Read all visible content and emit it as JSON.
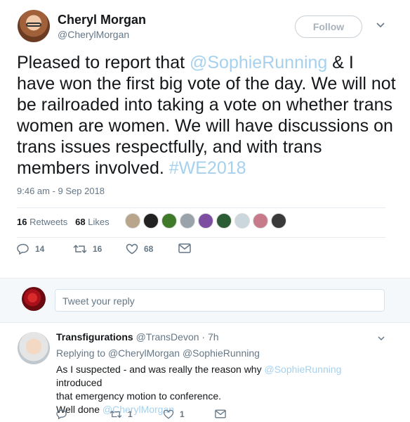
{
  "tweet": {
    "author_name": "Cheryl Morgan",
    "author_handle": "@CherylMorgan",
    "follow_label": "Follow",
    "text_before": "Pleased to report that ",
    "mention": "@SophieRunning",
    "text_after": " & I have won the first big vote of the day. We will not be railroaded into taking a vote on whether trans women are women. We will have discussions on trans issues respectfully, and with trans members involved. ",
    "hashtag": "#WE2018",
    "timestamp": "9:46 am - 9 Sep 2018",
    "retweets_count": "16",
    "retweets_label": "Retweets",
    "likes_count": "68",
    "likes_label": "Likes",
    "reply_count": "14",
    "retweet_count_action": "16",
    "like_count_action": "68"
  },
  "reply_box": {
    "placeholder": "Tweet your reply"
  },
  "reply": {
    "author_name": "Transfigurations",
    "author_handle": "@TransDevon",
    "time": "· 7h",
    "replying_prefix": "Replying to ",
    "replying_to": "@CherylMorgan @SophieRunning",
    "line1_before": "As I suspected - and was really the reason why ",
    "line1_mention": "@SophieRunning",
    "line1_after": " introduced",
    "line2": "that emergency motion to conference.",
    "line3_before": "Well done ",
    "line3_mention": "@CherylMorgan",
    "reply_count": "",
    "retweet_count": "1",
    "like_count": "1"
  },
  "colors": {
    "link": "#a6d1ee",
    "muted": "#657786",
    "text": "#14171a",
    "divider": "#e6ecf0"
  }
}
